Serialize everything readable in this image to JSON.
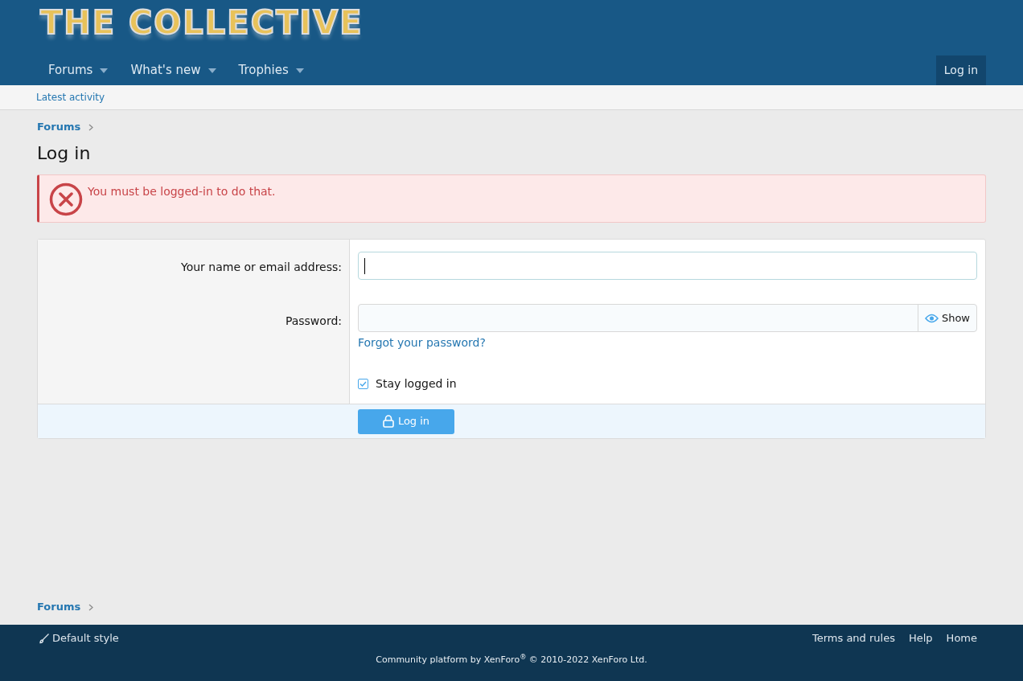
{
  "logo": {
    "text": "THE COLLECTIVE"
  },
  "nav": {
    "tabs": [
      {
        "label": "Forums",
        "selected": false
      },
      {
        "label": "What's new",
        "selected": false
      },
      {
        "label": "Trophies",
        "selected": false
      }
    ],
    "login": "Log in"
  },
  "subnav": [
    "Latest activity"
  ],
  "breadcrumb": [
    "Forums"
  ],
  "page_title": "Log in",
  "error": "You must be logged-in to do that.",
  "form": {
    "username_label": "Your name or email address:",
    "password_label": "Password:",
    "show": "Show",
    "forgot": "Forgot your password?",
    "stay": {
      "label": "Stay logged in",
      "checked": true
    },
    "submit": "Log in"
  },
  "bottom_breadcrumb": [
    "Forums"
  ],
  "footer": {
    "style": "Default style",
    "links": [
      "Terms and rules",
      "Help",
      "Home"
    ],
    "copyright": "Community platform by XenForo$^{®}$ © 2010-2022 XenForo Ltd."
  }
}
